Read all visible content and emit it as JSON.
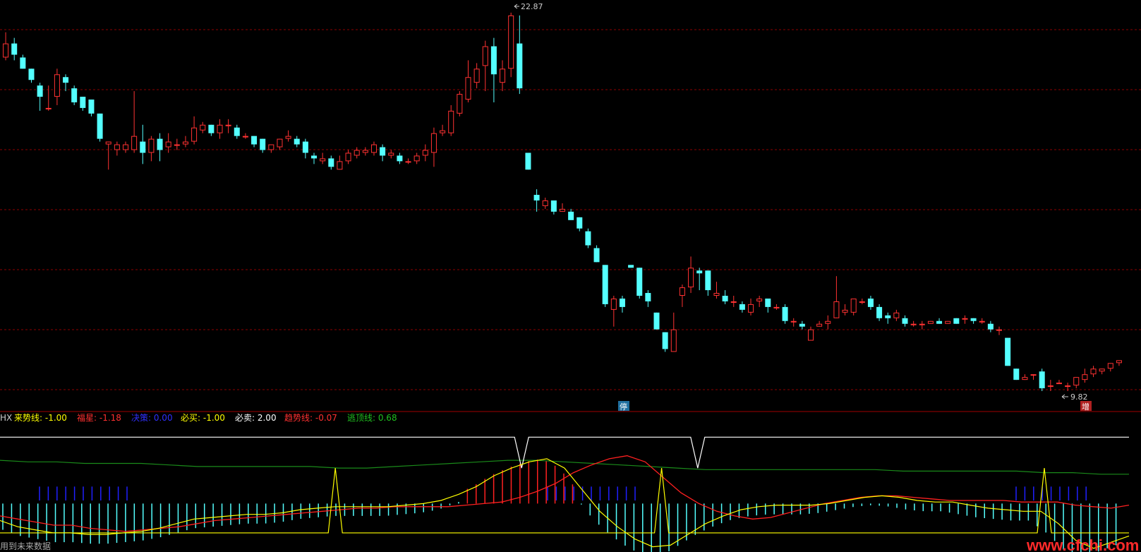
{
  "main_chart": {
    "high_label": "22.87",
    "low_label": "9.82",
    "marker_stop": "停",
    "marker_add": "增"
  },
  "indicator": {
    "name": "HX",
    "items": [
      {
        "label": "来势线",
        "value": "-1.00",
        "color": "#ffff00"
      },
      {
        "label": "福星",
        "value": "-1.18",
        "color": "#ff3030"
      },
      {
        "label": "决策",
        "value": "0.00",
        "color": "#3030ff"
      },
      {
        "label": "必买",
        "value": "-1.00",
        "color": "#ffff00"
      },
      {
        "label": "必卖",
        "value": "2.00",
        "color": "#ffffff"
      },
      {
        "label": "趋势线",
        "value": "-0.07",
        "color": "#ff3030"
      },
      {
        "label": "逃顶线",
        "value": "0.68",
        "color": "#20c020"
      }
    ],
    "footer_text": "用到未来数据"
  },
  "watermark": "www.cfchi.com",
  "colors": {
    "up": "#ff3232",
    "down": "#54ffff",
    "grid": "#8b0000",
    "yellow": "#ffff00",
    "red": "#ff2020",
    "green": "#1a9a1a",
    "white": "#ffffff",
    "blue": "#2020ff"
  },
  "chart_data": {
    "type": "candlestick",
    "price_ylim": [
      9.3,
      23.2
    ],
    "candles": [
      [
        21.3,
        21.8,
        22.2,
        21.2
      ],
      [
        21.8,
        21.4,
        22.0,
        21.2
      ],
      [
        21.3,
        20.9,
        21.4,
        20.9
      ],
      [
        20.9,
        20.5,
        20.9,
        20.4
      ],
      [
        20.3,
        19.9,
        20.4,
        19.4
      ],
      [
        19.5,
        19.5,
        20.3,
        19.4
      ],
      [
        19.9,
        20.7,
        20.9,
        19.6
      ],
      [
        20.6,
        20.4,
        20.7,
        20.1
      ],
      [
        20.2,
        19.7,
        20.3,
        19.6
      ],
      [
        19.9,
        19.5,
        19.9,
        19.4
      ],
      [
        19.8,
        19.3,
        19.8,
        19.2
      ],
      [
        19.3,
        18.4,
        19.3,
        18.3
      ],
      [
        18.2,
        18.3,
        18.3,
        17.3
      ],
      [
        18.0,
        18.2,
        18.3,
        17.8
      ],
      [
        18.0,
        18.2,
        18.3,
        17.9
      ],
      [
        18.0,
        18.5,
        20.1,
        17.9
      ],
      [
        18.3,
        17.9,
        18.9,
        17.5
      ],
      [
        17.9,
        18.4,
        18.5,
        17.6
      ],
      [
        18.4,
        18.0,
        18.6,
        17.6
      ],
      [
        18.1,
        18.3,
        18.6,
        17.9
      ],
      [
        18.2,
        18.2,
        18.4,
        18.0
      ],
      [
        18.2,
        18.3,
        18.5,
        18.1
      ],
      [
        18.3,
        18.8,
        19.2,
        18.2
      ],
      [
        18.7,
        18.9,
        19.0,
        18.6
      ],
      [
        18.9,
        18.6,
        18.9,
        18.5
      ],
      [
        18.6,
        18.9,
        19.1,
        18.4
      ],
      [
        18.9,
        18.9,
        19.1,
        18.6
      ],
      [
        18.8,
        18.5,
        18.9,
        18.4
      ],
      [
        18.5,
        18.5,
        18.6,
        18.4
      ],
      [
        18.5,
        18.2,
        18.5,
        18.1
      ],
      [
        18.4,
        18.0,
        18.4,
        17.9
      ],
      [
        18.0,
        18.2,
        18.2,
        17.9
      ],
      [
        18.1,
        18.4,
        18.4,
        18.0
      ],
      [
        18.4,
        18.5,
        18.7,
        18.3
      ],
      [
        18.4,
        18.2,
        18.5,
        18.1
      ],
      [
        18.3,
        17.9,
        18.4,
        17.7
      ],
      [
        17.8,
        17.7,
        17.9,
        17.5
      ],
      [
        17.6,
        17.7,
        17.9,
        17.5
      ],
      [
        17.7,
        17.4,
        17.8,
        17.3
      ],
      [
        17.3,
        17.6,
        17.8,
        17.3
      ],
      [
        17.6,
        17.9,
        18.0,
        17.5
      ],
      [
        17.8,
        18.0,
        18.1,
        17.7
      ],
      [
        17.9,
        18.0,
        18.1,
        17.8
      ],
      [
        17.9,
        18.2,
        18.3,
        17.8
      ],
      [
        18.1,
        17.8,
        18.2,
        17.6
      ],
      [
        17.8,
        17.9,
        18.0,
        17.7
      ],
      [
        17.8,
        17.6,
        17.9,
        17.5
      ],
      [
        17.6,
        17.6,
        17.7,
        17.5
      ],
      [
        17.6,
        17.8,
        17.9,
        17.5
      ],
      [
        17.8,
        18.0,
        18.2,
        17.6
      ],
      [
        17.9,
        18.6,
        18.8,
        17.4
      ],
      [
        18.6,
        18.7,
        18.9,
        18.5
      ],
      [
        18.6,
        19.4,
        19.6,
        18.5
      ],
      [
        19.3,
        20.0,
        20.1,
        19.2
      ],
      [
        19.8,
        20.6,
        21.2,
        19.7
      ],
      [
        20.4,
        20.9,
        21.1,
        20.2
      ],
      [
        21.0,
        21.7,
        21.9,
        20.1
      ],
      [
        21.7,
        20.7,
        22.0,
        19.7
      ],
      [
        20.4,
        20.9,
        21.2,
        20.1
      ],
      [
        20.9,
        22.8,
        22.9,
        20.6
      ],
      [
        21.8,
        20.2,
        22.8,
        20.0
      ],
      [
        17.9,
        17.3,
        17.9,
        17.3
      ],
      [
        16.4,
        16.2,
        16.6,
        15.8
      ],
      [
        16.0,
        16.2,
        16.3,
        15.9
      ],
      [
        16.2,
        15.8,
        16.2,
        15.7
      ],
      [
        15.8,
        15.9,
        16.1,
        15.8
      ],
      [
        15.8,
        15.5,
        15.9,
        15.5
      ],
      [
        15.6,
        15.2,
        15.6,
        15.1
      ],
      [
        15.1,
        14.6,
        15.2,
        14.5
      ],
      [
        14.5,
        14.0,
        14.6,
        14.0
      ],
      [
        13.9,
        12.5,
        13.9,
        12.4
      ],
      [
        12.3,
        12.7,
        12.8,
        11.7
      ],
      [
        12.7,
        12.4,
        12.8,
        12.2
      ],
      [
        13.9,
        13.8,
        13.9,
        13.8
      ],
      [
        13.8,
        12.8,
        13.8,
        12.7
      ],
      [
        12.9,
        12.6,
        13.0,
        12.4
      ],
      [
        12.2,
        11.6,
        12.2,
        11.6
      ],
      [
        11.5,
        10.9,
        11.5,
        10.8
      ],
      [
        10.8,
        11.6,
        12.2,
        10.8
      ],
      [
        12.8,
        13.1,
        13.2,
        12.4
      ],
      [
        13.1,
        13.8,
        14.2,
        12.9
      ],
      [
        13.7,
        13.6,
        13.8,
        13.0
      ],
      [
        13.7,
        13.0,
        13.7,
        12.8
      ],
      [
        12.8,
        12.9,
        13.3,
        12.7
      ],
      [
        12.8,
        12.6,
        13.0,
        12.5
      ],
      [
        12.6,
        12.6,
        12.8,
        12.4
      ],
      [
        12.5,
        12.3,
        12.6,
        12.2
      ],
      [
        12.2,
        12.5,
        12.7,
        12.1
      ],
      [
        12.6,
        12.7,
        12.8,
        12.4
      ],
      [
        12.7,
        12.4,
        12.7,
        12.2
      ],
      [
        12.4,
        12.4,
        12.5,
        12.3
      ],
      [
        12.4,
        11.9,
        12.5,
        11.8
      ],
      [
        11.9,
        11.9,
        12.0,
        11.7
      ],
      [
        11.8,
        11.7,
        11.9,
        11.6
      ],
      [
        11.2,
        11.6,
        11.7,
        11.2
      ],
      [
        11.7,
        11.8,
        11.9,
        11.7
      ],
      [
        11.8,
        11.9,
        12.1,
        11.6
      ],
      [
        12.0,
        12.6,
        13.5,
        12.0
      ],
      [
        12.2,
        12.3,
        12.5,
        12.1
      ],
      [
        12.2,
        12.7,
        12.7,
        12.1
      ],
      [
        12.6,
        12.6,
        12.7,
        12.5
      ],
      [
        12.7,
        12.4,
        12.8,
        12.3
      ],
      [
        12.4,
        12.0,
        12.5,
        11.9
      ],
      [
        12.1,
        12.0,
        12.2,
        11.8
      ],
      [
        12.0,
        12.2,
        12.3,
        11.9
      ],
      [
        12.0,
        11.8,
        12.1,
        11.7
      ],
      [
        11.8,
        11.8,
        11.9,
        11.7
      ],
      [
        11.8,
        11.8,
        11.9,
        11.6
      ],
      [
        11.8,
        11.9,
        11.9,
        11.8
      ],
      [
        11.9,
        11.8,
        12.0,
        11.8
      ],
      [
        11.8,
        11.9,
        11.9,
        11.8
      ],
      [
        12.0,
        11.8,
        12.0,
        11.8
      ],
      [
        12.0,
        12.0,
        12.1,
        11.8
      ],
      [
        12.0,
        11.9,
        12.0,
        11.8
      ],
      [
        11.9,
        11.9,
        12.0,
        11.8
      ],
      [
        11.8,
        11.6,
        11.9,
        11.5
      ],
      [
        11.6,
        11.6,
        11.7,
        11.4
      ],
      [
        11.3,
        10.3,
        11.3,
        10.3
      ],
      [
        10.2,
        9.8,
        10.2,
        9.8
      ],
      [
        9.8,
        9.9,
        10.0,
        9.8
      ],
      [
        10.0,
        10.0,
        10.0,
        9.8
      ],
      [
        10.1,
        9.5,
        10.2,
        9.4
      ],
      [
        9.6,
        9.6,
        9.8,
        9.4
      ],
      [
        9.7,
        9.7,
        9.8,
        9.7
      ],
      [
        9.6,
        9.6,
        9.7,
        9.4
      ],
      [
        9.6,
        9.9,
        9.9,
        9.5
      ],
      [
        9.8,
        10.0,
        10.2,
        9.7
      ],
      [
        10.0,
        10.2,
        10.3,
        9.9
      ],
      [
        10.1,
        10.2,
        10.2,
        10.0
      ],
      [
        10.2,
        10.4,
        10.4,
        10.1
      ],
      [
        10.4,
        10.5,
        10.5,
        10.3
      ]
    ],
    "indicator_ylim": [
      -4,
      4
    ],
    "trend_line": [
      -1.8,
      -2.0,
      -2.2,
      -2.4,
      -2.4,
      -2.6,
      -2.7,
      -2.8,
      -2.7,
      -2.6,
      -2.5,
      -2.3,
      -2.1,
      -2.0,
      -1.9,
      -1.8,
      -1.7,
      -1.6,
      -1.5,
      -1.4,
      -1.3,
      -1.3,
      -1.2,
      -1.2,
      -1.2,
      -1.2,
      -1.1,
      -1.0,
      -0.9,
      -0.6,
      -0.2,
      0.3,
      1.0,
      1.5,
      1.9,
      2.1,
      1.7,
      0.7,
      -0.3,
      -1.0,
      -1.5,
      -1.8,
      -2.0,
      -1.9,
      -1.6,
      -1.3,
      -1.0,
      -0.8,
      -0.6,
      -0.5,
      -0.5,
      -0.6,
      -0.7,
      -0.8,
      -0.8,
      -0.8,
      -0.8,
      -0.9,
      -0.9,
      -0.9,
      -1.1,
      -1.2,
      -1.3,
      -1.1
    ],
    "come_line": [
      -2.1,
      -2.5,
      -2.7,
      -2.9,
      -2.9,
      -3.0,
      -3.0,
      -2.9,
      -2.8,
      -2.6,
      -2.3,
      -2.0,
      -1.9,
      -1.8,
      -1.7,
      -1.7,
      -1.6,
      -1.4,
      -1.3,
      -1.2,
      -1.2,
      -1.2,
      -1.2,
      -1.1,
      -1.0,
      -0.8,
      -0.4,
      0.1,
      0.8,
      1.3,
      1.7,
      1.9,
      1.3,
      -0.1,
      -1.5,
      -2.5,
      -3.3,
      -3.8,
      -3.7,
      -3.0,
      -2.3,
      -1.8,
      -1.4,
      -1.2,
      -1.1,
      -1.1,
      -1.1,
      -1.0,
      -0.8,
      -0.6,
      -0.5,
      -0.6,
      -0.8,
      -0.9,
      -0.9,
      -1.1,
      -1.3,
      -1.4,
      -1.5,
      -1.5,
      -2.3,
      -3.4,
      -3.9,
      -3.5,
      -3.1
    ],
    "top_line": [
      1.8,
      1.7,
      1.7,
      1.6,
      1.6,
      1.6,
      1.5,
      1.4,
      1.4,
      1.4,
      1.4,
      1.4,
      1.3,
      1.3,
      1.4,
      1.5,
      1.6,
      1.7,
      1.8,
      1.8,
      1.7,
      1.6,
      1.5,
      1.4,
      1.3,
      1.2,
      1.2,
      1.2,
      1.2,
      1.2,
      1.2,
      1.2,
      1.1,
      1.1,
      1.1,
      1.1,
      1.1,
      1.0,
      1.0,
      0.9,
      0.9
    ],
    "buy_signal_positions": [
      0.297,
      0.586,
      0.925
    ],
    "sell_signal_positions": [
      0.462,
      0.618
    ]
  }
}
